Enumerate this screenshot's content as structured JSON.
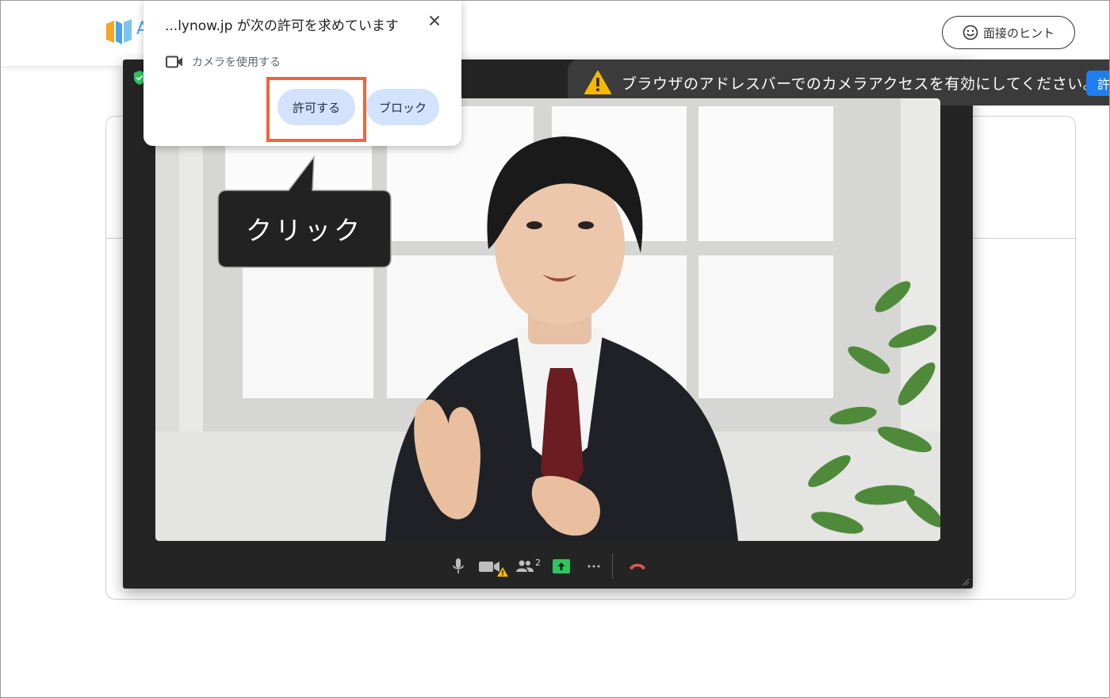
{
  "header": {
    "logo_letter": "A",
    "hint_button_label": "面接のヒント"
  },
  "permission_prompt": {
    "title": "...lynow.jp が次の許可を求めています",
    "permission_label": "カメラを使用する",
    "allow_label": "許可する",
    "block_label": "ブロック"
  },
  "callout": {
    "text": "クリック"
  },
  "warning_bar": {
    "message": "ブラウザのアドレスバーでのカメラアクセスを有効にしてください。",
    "button_label": "許"
  },
  "controls": {
    "participant_count": "2"
  },
  "colors": {
    "highlight": "#f0643c",
    "button_bg": "#d3e3fd",
    "meeting_bg": "#242424",
    "end_call": "#e05555",
    "share_green": "#2fc45f"
  }
}
